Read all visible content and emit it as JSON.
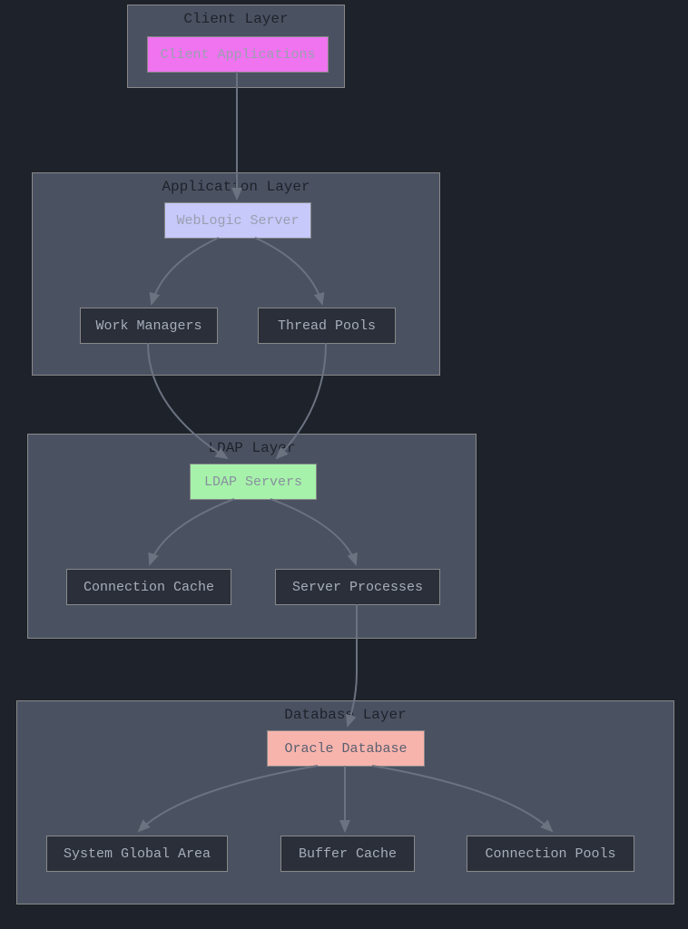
{
  "layers": {
    "client": {
      "title": "Client Layer",
      "node": {
        "label": "Client Applications"
      }
    },
    "application": {
      "title": "Application Layer",
      "root": {
        "label": "WebLogic Server"
      },
      "children": [
        {
          "label": "Work Managers"
        },
        {
          "label": "Thread Pools"
        }
      ]
    },
    "ldap": {
      "title": "LDAP Layer",
      "root": {
        "label": "LDAP Servers"
      },
      "children": [
        {
          "label": "Connection Cache"
        },
        {
          "label": "Server Processes"
        }
      ]
    },
    "database": {
      "title": "Database Layer",
      "root": {
        "label": "Oracle Database"
      },
      "children": [
        {
          "label": "System Global Area"
        },
        {
          "label": "Buffer Cache"
        },
        {
          "label": "Connection Pools"
        }
      ]
    }
  }
}
